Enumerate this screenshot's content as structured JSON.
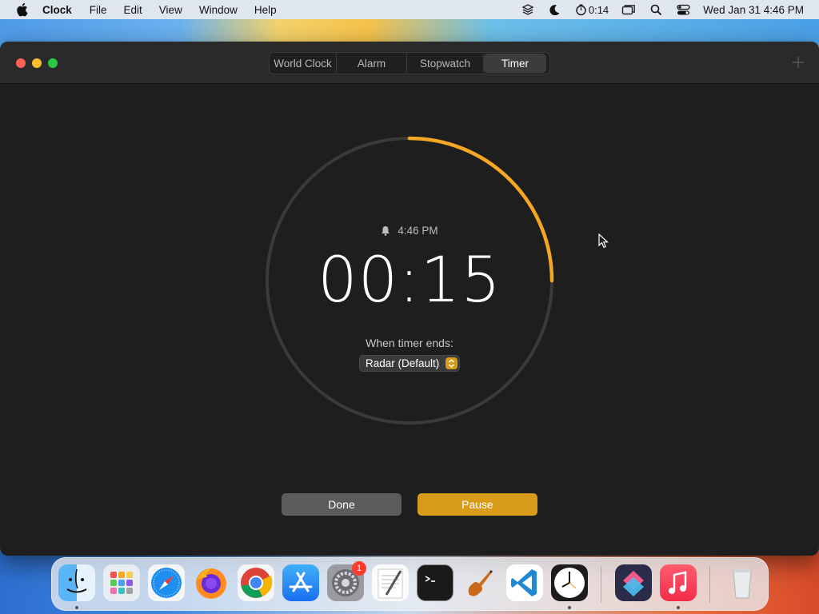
{
  "menubar": {
    "app_name": "Clock",
    "items": [
      "File",
      "Edit",
      "View",
      "Window",
      "Help"
    ],
    "timer_status": "0:14",
    "datetime": "Wed Jan 31  4:46 PM"
  },
  "window": {
    "tabs": [
      {
        "label": "World Clock",
        "active": false
      },
      {
        "label": "Alarm",
        "active": false
      },
      {
        "label": "Stopwatch",
        "active": false
      },
      {
        "label": "Timer",
        "active": true
      }
    ]
  },
  "timer": {
    "alarm_time": "4:46 PM",
    "remaining": "00:15",
    "progress_fraction": 0.25,
    "ends_label": "When timer ends:",
    "sound": "Radar (Default)",
    "done_label": "Done",
    "pause_label": "Pause",
    "accent_color": "#F5A623"
  },
  "dock": {
    "apps": [
      "Finder",
      "Launchpad",
      "Safari",
      "Firefox",
      "Chrome",
      "App Store",
      "System Settings",
      "TextEdit",
      "Terminal",
      "GarageBand",
      "Visual Studio Code",
      "Clock",
      "Shortcuts",
      "Music",
      "Trash"
    ],
    "settings_badge": "1"
  }
}
